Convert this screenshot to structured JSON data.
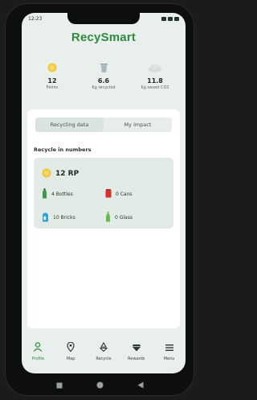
{
  "status": {
    "time": "12:23"
  },
  "app": {
    "title": "RecySmart"
  },
  "stats": [
    {
      "icon": "coin-icon",
      "value": "12",
      "label": "Points"
    },
    {
      "icon": "trash-bin-icon",
      "value": "6.6",
      "label": "Kg recycled"
    },
    {
      "icon": "cloud-icon",
      "value": "11.8",
      "label": "Kg saved CO2"
    }
  ],
  "tabs": [
    {
      "label": "Recycling data",
      "active": true
    },
    {
      "label": "My impact",
      "active": false
    }
  ],
  "section": {
    "title": "Recycle in numbers"
  },
  "card": {
    "points": "12 RP",
    "items": [
      {
        "icon": "bottle-icon",
        "label": "4 Bottles"
      },
      {
        "icon": "can-icon",
        "label": "0 Cans"
      },
      {
        "icon": "brick-icon",
        "label": "10 Bricks"
      },
      {
        "icon": "glass-icon",
        "label": "0 Glass"
      }
    ]
  },
  "nav": [
    {
      "icon": "profile-icon",
      "label": "Profile",
      "active": true
    },
    {
      "icon": "map-pin-icon",
      "label": "Map",
      "active": false
    },
    {
      "icon": "recycle-icon",
      "label": "Recycle",
      "active": false
    },
    {
      "icon": "diamond-icon",
      "label": "Rewards",
      "active": false
    },
    {
      "icon": "menu-icon",
      "label": "Menu",
      "active": false
    }
  ],
  "colors": {
    "brand": "#2e8b3d",
    "background": "#e9efec",
    "card": "#e3ebe7"
  }
}
